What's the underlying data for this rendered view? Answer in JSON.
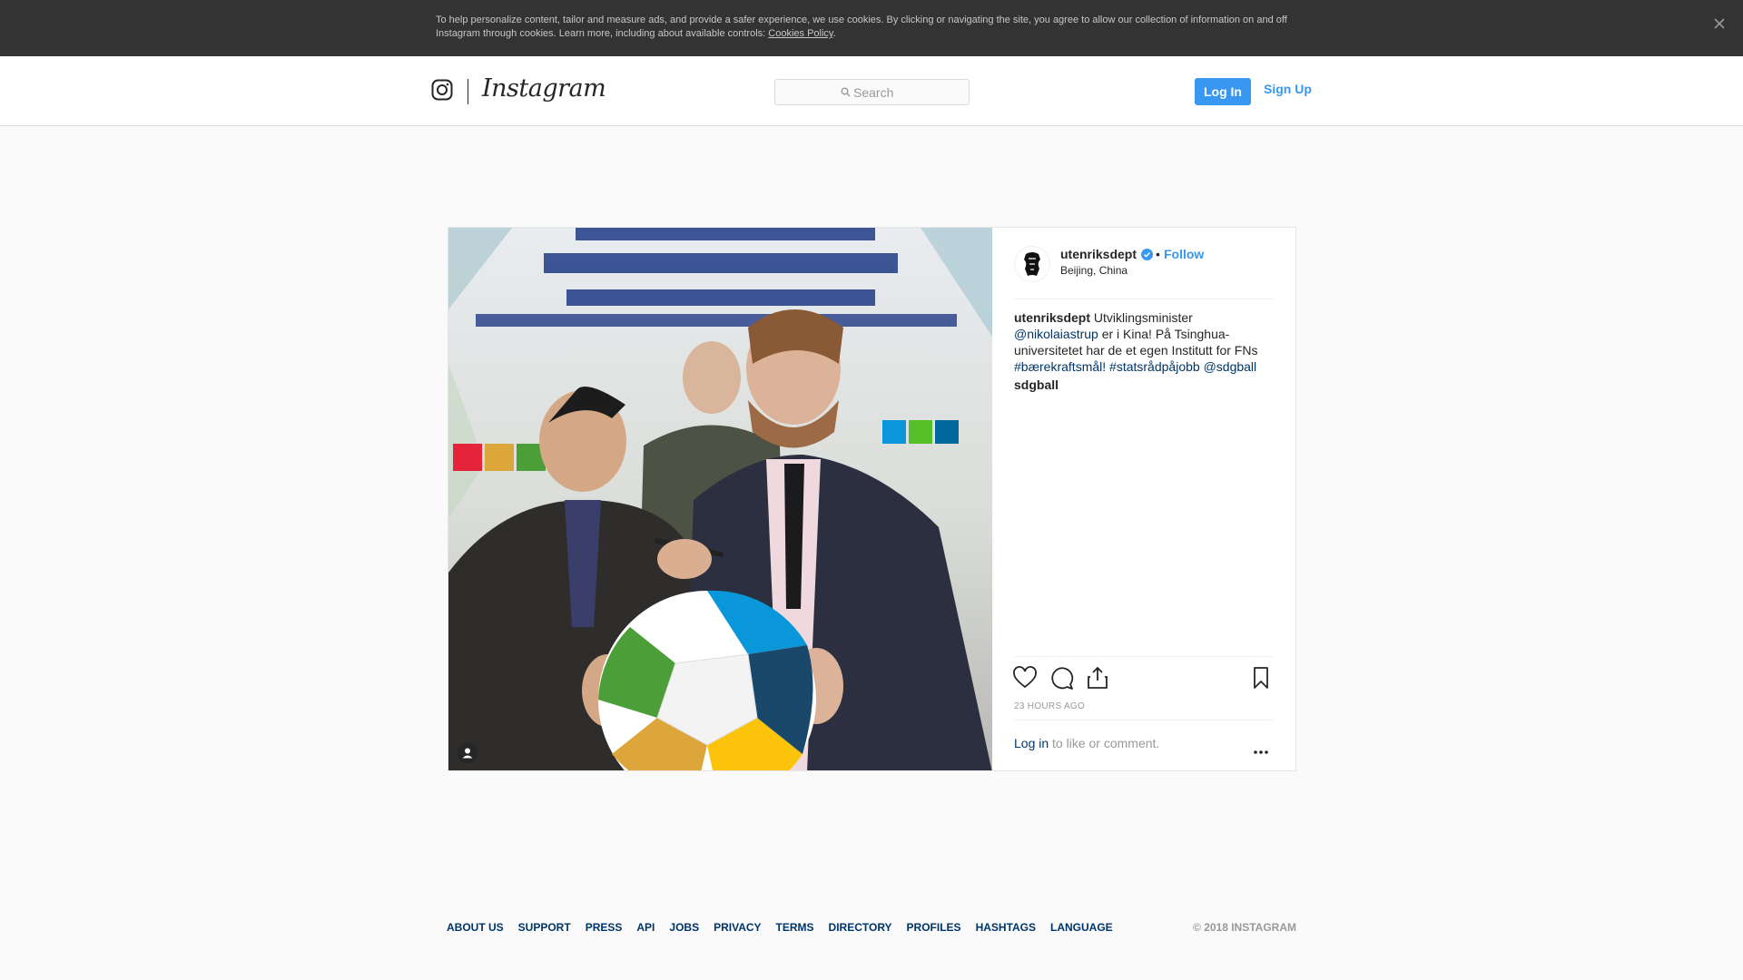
{
  "cookie_banner": {
    "text": "To help personalize content, tailor and measure ads, and provide a safer experience, we use cookies. By clicking or navigating the site, you agree to allow our collection of information on and off Instagram through cookies. Learn more, including about available controls: ",
    "link": "Cookies Policy",
    "suffix": "."
  },
  "header": {
    "wordmark": "Instagram",
    "search_placeholder": "Search",
    "login_label": "Log In",
    "signup_label": "Sign Up"
  },
  "post": {
    "username": "utenriksdept",
    "separator": "•",
    "follow_label": "Follow",
    "location": "Beijing, China",
    "caption": {
      "username": "utenriksdept",
      "text1": " Utviklingsminister ",
      "mention1": "@nikolaiastrup",
      "text2": " er i Kina!  På Tsinghua-universitetet har de et egen Institutt for FNs ",
      "hashtag1": "#bærekraftsmål!",
      "text3": "  ",
      "hashtag2": "#statsrådpåjobb",
      "text4": " ",
      "mention2": "@sdgball"
    },
    "second_line": "sdgball  ",
    "time": "23 HOURS AGO",
    "login_link": "Log in",
    "login_suffix": " to like or comment.",
    "icons": [
      "heart-icon",
      "comment-icon",
      "share-icon",
      "bookmark-icon",
      "more-icon",
      "user-tag-icon"
    ]
  },
  "footer": {
    "links": [
      "ABOUT US",
      "SUPPORT",
      "PRESS",
      "API",
      "JOBS",
      "PRIVACY",
      "TERMS",
      "DIRECTORY",
      "PROFILES",
      "HASHTAGS",
      "LANGUAGE"
    ],
    "copyright": "© 2018 INSTAGRAM"
  },
  "colors": {
    "accent": "#3897f0",
    "link": "#003569",
    "banner": "#333333"
  }
}
